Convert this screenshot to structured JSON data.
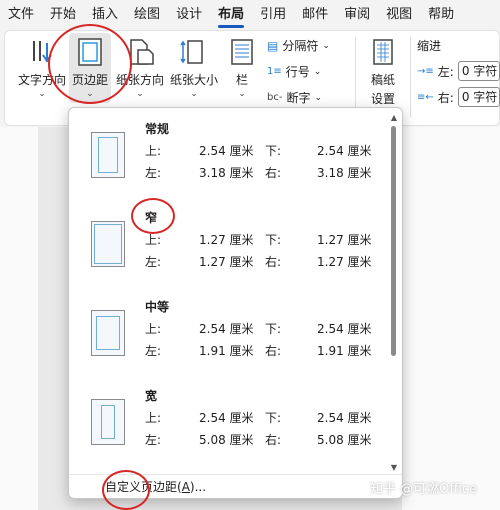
{
  "tabs": [
    "文件",
    "开始",
    "插入",
    "绘图",
    "设计",
    "布局",
    "引用",
    "邮件",
    "审阅",
    "视图",
    "帮助"
  ],
  "active_tab": "布局",
  "ribbon": {
    "text_direction": "文字方向",
    "margins": "页边距",
    "orientation": "纸张方向",
    "size": "纸张大小",
    "columns": "栏",
    "breaks": "分隔符",
    "line_numbers": "行号",
    "hyphenation": "断字",
    "draft_paper": "稿纸\n设置",
    "draft_paper_1": "稿纸",
    "draft_paper_2": "设置",
    "indent": "缩进",
    "indent_left_label": "左:",
    "indent_left_value": "0 字符",
    "indent_right_label": "右:",
    "indent_right_value": "0 字符"
  },
  "margin_presets": [
    {
      "name": "常规",
      "top_label": "上:",
      "top": "2.54 厘米",
      "bottom_label": "下:",
      "bottom": "2.54 厘米",
      "left_label": "左:",
      "left": "3.18 厘米",
      "right_label": "右:",
      "right": "3.18 厘米"
    },
    {
      "name": "窄",
      "top_label": "上:",
      "top": "1.27 厘米",
      "bottom_label": "下:",
      "bottom": "1.27 厘米",
      "left_label": "左:",
      "left": "1.27 厘米",
      "right_label": "右:",
      "right": "1.27 厘米"
    },
    {
      "name": "中等",
      "top_label": "上:",
      "top": "2.54 厘米",
      "bottom_label": "下:",
      "bottom": "2.54 厘米",
      "left_label": "左:",
      "left": "1.91 厘米",
      "right_label": "右:",
      "right": "1.91 厘米"
    },
    {
      "name": "宽",
      "top_label": "上:",
      "top": "2.54 厘米",
      "bottom_label": "下:",
      "bottom": "2.54 厘米",
      "left_label": "左:",
      "left": "5.08 厘米",
      "right_label": "右:",
      "right": "5.08 厘米"
    }
  ],
  "custom_margins_prefix": "自定义页边距(",
  "custom_margins_key": "A",
  "custom_margins_suffix": ")...",
  "watermark": "知乎 @可燃Office",
  "colors": {
    "accent": "#185abd",
    "annotation": "#d62626"
  }
}
